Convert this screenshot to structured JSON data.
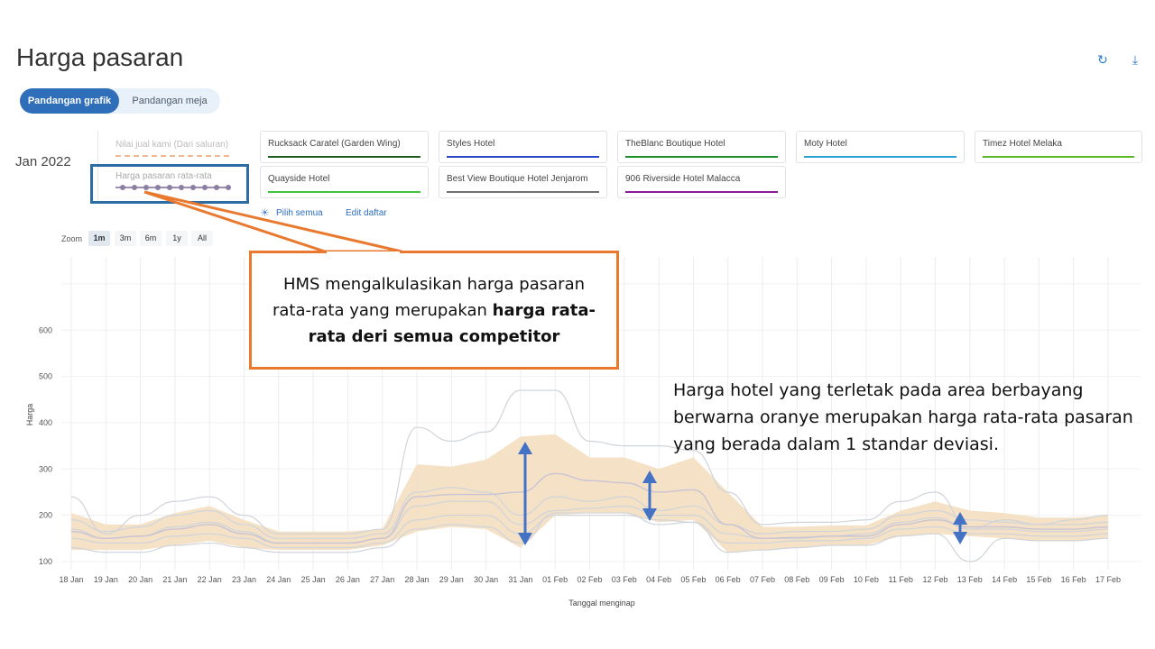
{
  "page": {
    "title": "Harga pasaran",
    "refresh_icon": "refresh-icon",
    "download_icon": "download-icon"
  },
  "view_toggle": {
    "chart_label": "Pandangan grafik",
    "table_label": "Pandangan meja"
  },
  "period_label": "Jan 2022",
  "legend": {
    "own_price": "Nilai jual kami (Dari saluran)",
    "market_average": "Harga pasaran rata-rata"
  },
  "competitors": [
    {
      "name": "Rucksack Caratel (Garden Wing)",
      "color": "#1f5c1f"
    },
    {
      "name": "Styles Hotel",
      "color": "#2a44c8"
    },
    {
      "name": "TheBlanc Boutique Hotel",
      "color": "#1a8f2a"
    },
    {
      "name": "Moty Hotel",
      "color": "#2a9fd8"
    },
    {
      "name": "Timez Hotel Melaka",
      "color": "#5bb82a"
    },
    {
      "name": "Quayside Hotel",
      "color": "#3ec43e"
    },
    {
      "name": "Best View Boutique Hotel Jenjarom",
      "color": "#707070"
    },
    {
      "name": "906 Riverside Hotel Malacca",
      "color": "#8a1a9a"
    }
  ],
  "links": {
    "select_all": "Pilih semua",
    "edit_list": "Edit daftar"
  },
  "zoom": {
    "label": "Zoom",
    "options": [
      "1m",
      "3m",
      "6m",
      "1y",
      "All"
    ],
    "selected": "1m"
  },
  "callout": {
    "line1": "HMS mengalkulasikan harga pasaran",
    "line2_normal": "rata-rata yang merupakan ",
    "line2_bold": "harga rata-",
    "line3_bold": "rata deri semua competitor"
  },
  "note": "Harga hotel yang terletak pada area berbayang berwarna oranye merupakan harga rata-rata pasaran yang berada dalam 1 standar deviasi.",
  "colors": {
    "accent": "#2f6fba",
    "callout_border": "#e8792f",
    "band_fill": "#f3dfc3",
    "arrow": "#4472c4"
  },
  "chart_data": {
    "type": "area",
    "ylabel": "Harga",
    "xlabel": "Tanggal menginap",
    "yticks": [
      100,
      200,
      300,
      400,
      500,
      600
    ],
    "ylim": [
      80,
      720
    ],
    "categories": [
      "18 Jan",
      "19 Jan",
      "20 Jan",
      "21 Jan",
      "22 Jan",
      "23 Jan",
      "24 Jan",
      "25 Jan",
      "26 Jan",
      "27 Jan",
      "28 Jan",
      "29 Jan",
      "30 Jan",
      "31 Jan",
      "01 Feb",
      "02 Feb",
      "03 Feb",
      "04 Feb",
      "05 Feb",
      "06 Feb",
      "07 Feb",
      "08 Feb",
      "09 Feb",
      "10 Feb",
      "11 Feb",
      "12 Feb",
      "13 Feb",
      "14 Feb",
      "15 Feb",
      "16 Feb",
      "17 Feb"
    ],
    "band_upper": [
      205,
      180,
      180,
      205,
      220,
      190,
      165,
      165,
      165,
      170,
      310,
      305,
      320,
      370,
      375,
      325,
      325,
      300,
      325,
      250,
      175,
      175,
      178,
      178,
      210,
      230,
      210,
      205,
      195,
      195,
      200
    ],
    "band_lower": [
      125,
      125,
      125,
      135,
      145,
      130,
      125,
      125,
      125,
      135,
      165,
      175,
      170,
      130,
      200,
      205,
      205,
      185,
      190,
      120,
      125,
      130,
      135,
      135,
      155,
      160,
      155,
      150,
      145,
      145,
      150
    ],
    "series": [
      {
        "values": [
          240,
          160,
          200,
          230,
          240,
          200,
          160,
          160,
          160,
          170,
          390,
          360,
          380,
          470,
          470,
          360,
          350,
          350,
          340,
          250,
          180,
          185,
          185,
          190,
          230,
          250,
          170,
          190,
          180,
          190,
          200
        ]
      },
      {
        "values": [
          190,
          165,
          175,
          200,
          210,
          180,
          150,
          150,
          150,
          160,
          250,
          260,
          250,
          200,
          240,
          230,
          240,
          210,
          220,
          180,
          160,
          165,
          165,
          170,
          200,
          210,
          190,
          185,
          180,
          180,
          185
        ]
      },
      {
        "values": [
          170,
          150,
          155,
          175,
          185,
          165,
          140,
          140,
          140,
          150,
          220,
          230,
          230,
          180,
          210,
          215,
          220,
          200,
          200,
          160,
          150,
          150,
          155,
          160,
          185,
          195,
          170,
          170,
          165,
          165,
          170
        ]
      },
      {
        "values": [
          150,
          140,
          140,
          155,
          160,
          150,
          130,
          130,
          130,
          140,
          190,
          200,
          200,
          160,
          200,
          200,
          200,
          190,
          185,
          140,
          140,
          145,
          145,
          150,
          170,
          175,
          160,
          160,
          155,
          155,
          160
        ]
      },
      {
        "values": [
          130,
          120,
          120,
          135,
          140,
          130,
          120,
          120,
          120,
          130,
          170,
          180,
          175,
          140,
          205,
          205,
          205,
          180,
          185,
          120,
          125,
          130,
          135,
          135,
          155,
          160,
          100,
          150,
          145,
          145,
          150
        ]
      }
    ],
    "average": {
      "values": [
        165,
        150,
        155,
        170,
        180,
        160,
        140,
        140,
        140,
        150,
        240,
        245,
        245,
        250,
        290,
        275,
        270,
        250,
        255,
        180,
        150,
        152,
        155,
        155,
        180,
        190,
        175,
        175,
        170,
        170,
        175
      ]
    }
  }
}
